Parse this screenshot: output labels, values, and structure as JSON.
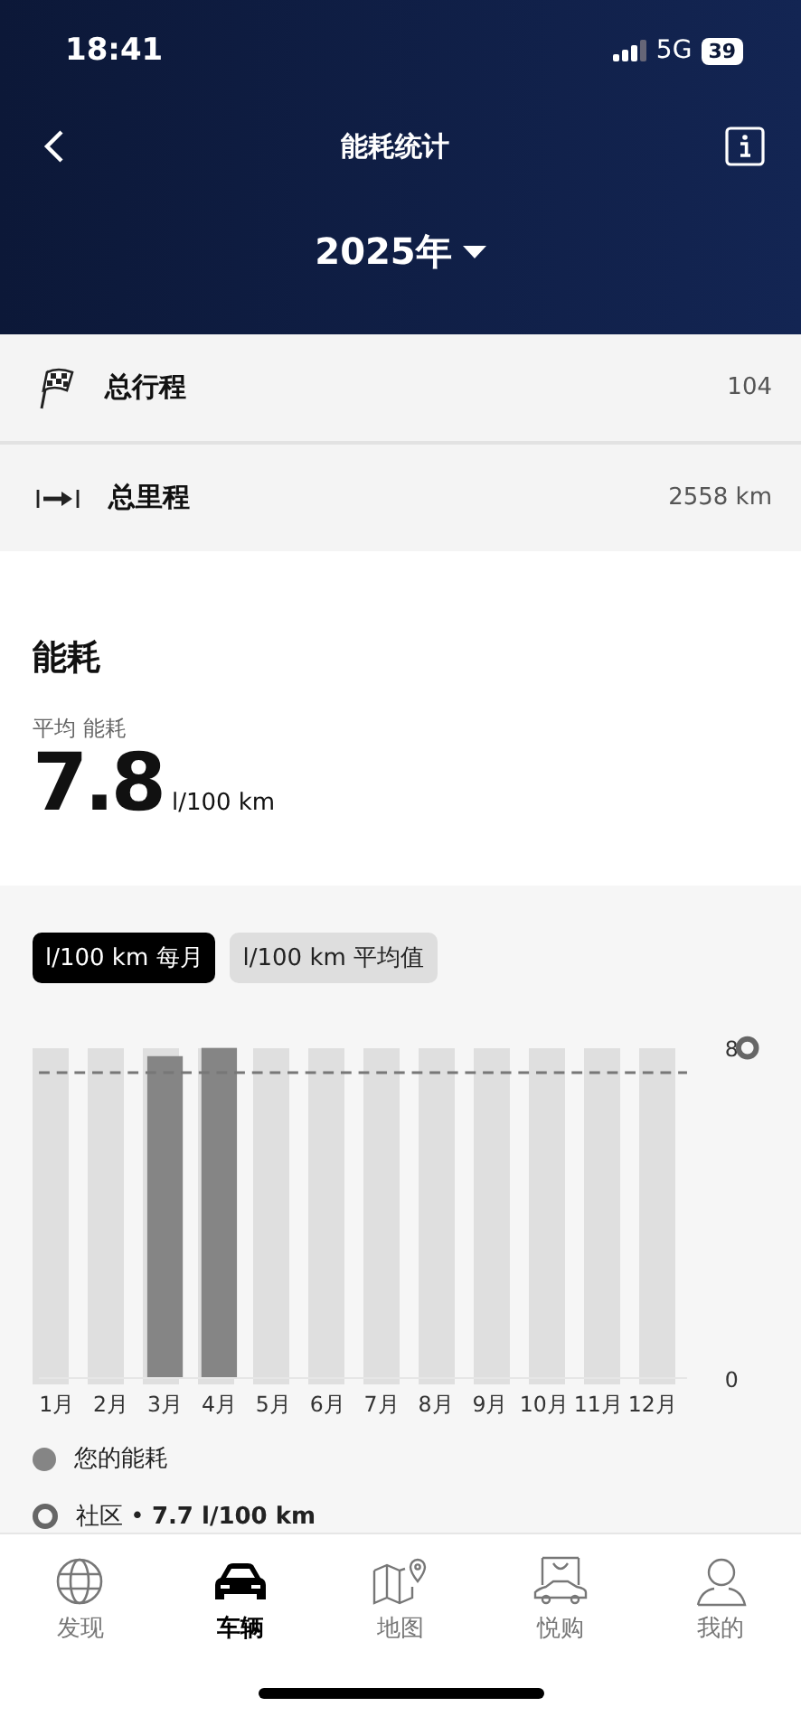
{
  "status_bar": {
    "time": "18:41",
    "network": "5G",
    "battery": "39"
  },
  "header": {
    "title": "能耗统计",
    "year": "2025年"
  },
  "summary": [
    {
      "kind": "trips",
      "label": "总行程",
      "value": "104"
    },
    {
      "kind": "distance",
      "label": "总里程",
      "value": "2558 km"
    }
  ],
  "consumption": {
    "title": "能耗",
    "avg_label": "平均 能耗",
    "avg_value": "7.8",
    "avg_unit": "l/100 km"
  },
  "chart_tabs": [
    {
      "label": "l/100 km 每月",
      "selected": true
    },
    {
      "label": "l/100 km 平均值",
      "selected": false
    }
  ],
  "chart": {
    "chart_data": {
      "type": "bar",
      "categories": [
        "1月",
        "2月",
        "3月",
        "4月",
        "5月",
        "6月",
        "7月",
        "8月",
        "9月",
        "10月",
        "11月",
        "12月"
      ],
      "series": [
        {
          "name": "您的能耗",
          "color": "#858585",
          "values": [
            null,
            null,
            7.8,
            8,
            null,
            null,
            null,
            null,
            null,
            null,
            null,
            null
          ]
        }
      ],
      "ylim": [
        0,
        8
      ],
      "yticks": [
        0,
        8
      ],
      "ref_lines": [
        {
          "axis": "y",
          "value": 7.4
        }
      ]
    }
  },
  "legend": [
    {
      "kind": "ring",
      "text": "社区 • **7.7 l/100 km**"
    }
  ],
  "nav": [
    {
      "kind": "globe",
      "label": "发现",
      "selected": false
    },
    {
      "kind": "car",
      "label": "车辆",
      "selected": true
    },
    {
      "kind": "map",
      "label": "地图",
      "selected": false
    },
    {
      "kind": "shop",
      "label": "悦购",
      "selected": false
    },
    {
      "kind": "person",
      "label": "我的",
      "selected": false
    }
  ]
}
